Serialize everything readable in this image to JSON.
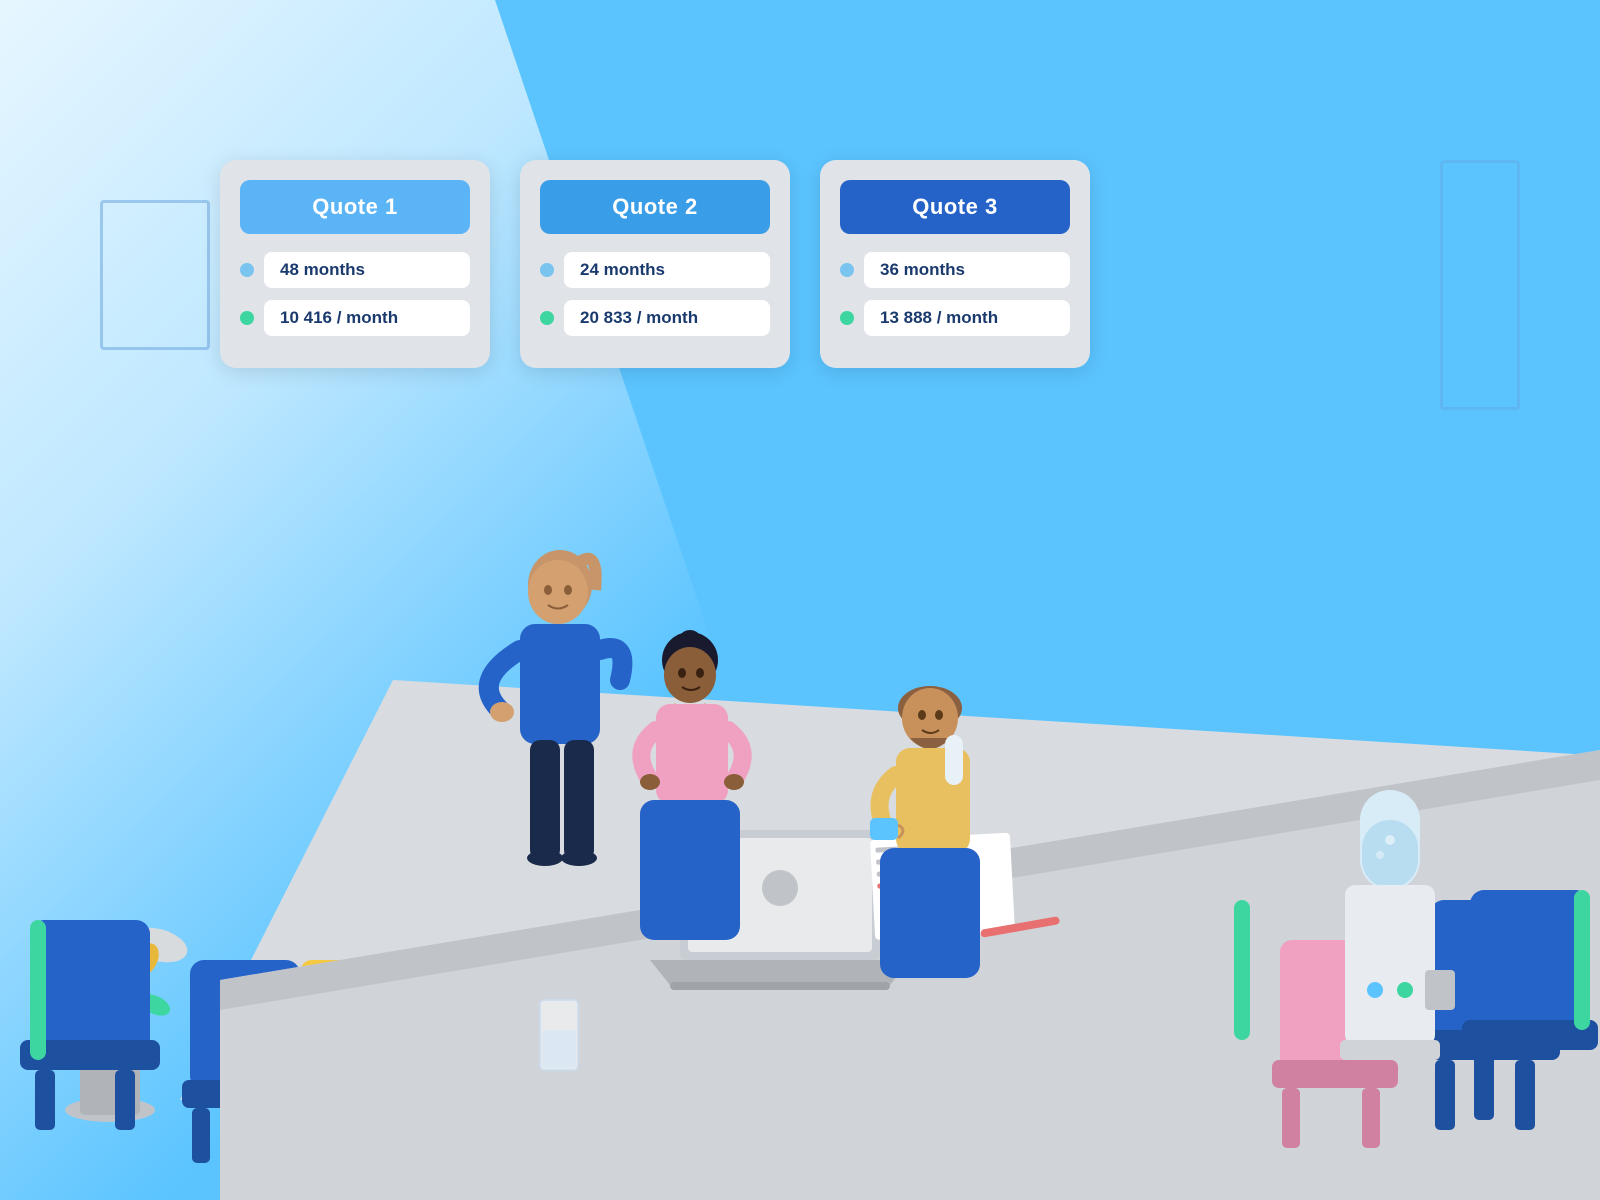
{
  "background": {
    "color": "#5bc4ff"
  },
  "cards": [
    {
      "id": "quote1",
      "title": "Quote 1",
      "header_style": "light",
      "duration_label": "48 months",
      "price_label": "10 416 / month"
    },
    {
      "id": "quote2",
      "title": "Quote 2",
      "header_style": "medium",
      "duration_label": "24 months",
      "price_label": "20 833 / month"
    },
    {
      "id": "quote3",
      "title": "Quote 3",
      "header_style": "dark",
      "duration_label": "36 months",
      "price_label": "13 888 / month"
    }
  ]
}
